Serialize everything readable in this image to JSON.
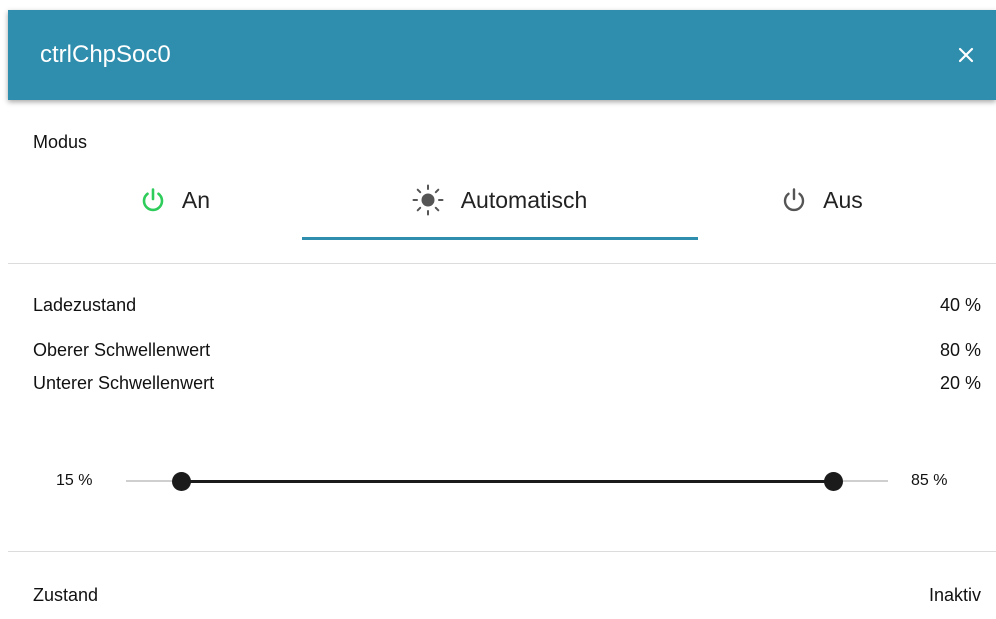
{
  "dialog": {
    "title": "ctrlChpSoc0",
    "close_icon": "close-icon"
  },
  "mode": {
    "label": "Modus",
    "tabs": [
      {
        "label": "An",
        "icon": "power-icon",
        "color": "#2ecc5a"
      },
      {
        "label": "Automatisch",
        "icon": "sun-icon",
        "color": "#555555"
      },
      {
        "label": "Aus",
        "icon": "power-icon",
        "color": "#555555"
      }
    ],
    "selected": "Automatisch",
    "accent": "#2f8ead"
  },
  "info": {
    "rows": [
      {
        "label": "Ladezustand",
        "value": "40 %"
      },
      {
        "label": "Oberer Schwellenwert",
        "value": "80 %"
      },
      {
        "label": "Unterer Schwellenwert",
        "value": "20 %"
      }
    ]
  },
  "slider": {
    "min_label": "15 %",
    "max_label": "85 %",
    "low_value": 20,
    "high_value": 80,
    "range_min": 15,
    "range_max": 85
  },
  "status": {
    "label": "Zustand",
    "value": "Inaktiv"
  }
}
